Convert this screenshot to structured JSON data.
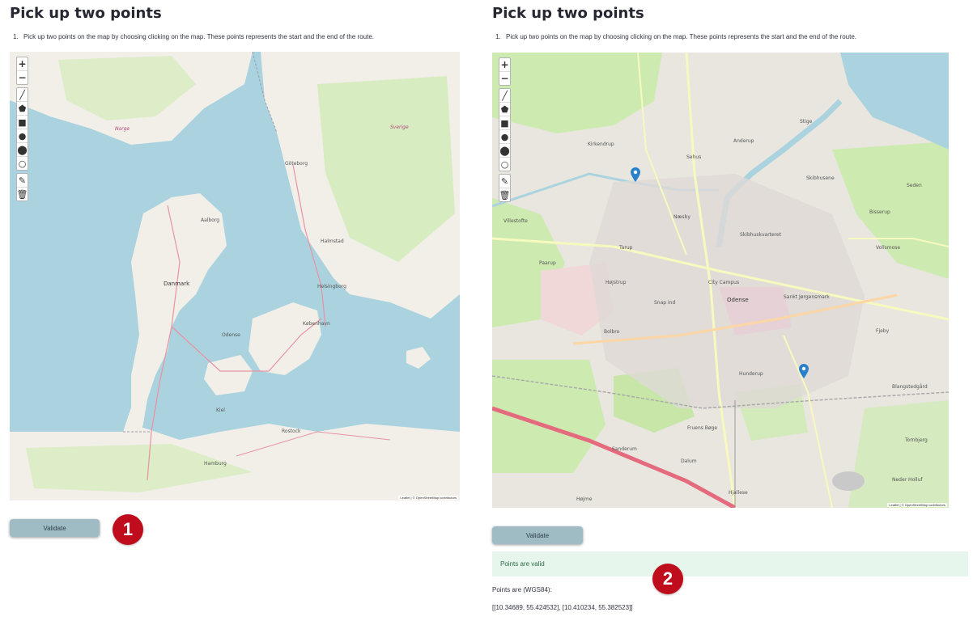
{
  "left": {
    "title": "Pick up two points",
    "instruction": "Pick up two points on the map by choosing clicking on the map. These points represents the start and the end of the route.",
    "validate_label": "Validate",
    "badge": "1",
    "attribution": "Leaflet | © OpenStreetMap contributors",
    "labels": {
      "danmark": "Danmark",
      "goteborg": "Göteborg",
      "aalborg": "Aalborg",
      "kobenhavn": "København",
      "odense": "Odense",
      "hamburg": "Hamburg",
      "kiel": "Kiel",
      "rostock": "Rostock",
      "helsingborg": "Helsingborg",
      "halmstad": "Halmstad",
      "norge": "Norge",
      "sverige": "Sverige"
    }
  },
  "right": {
    "title": "Pick up two points",
    "instruction": "Pick up two points on the map by choosing clicking on the map. These points represents the start and the end of the route.",
    "validate_label": "Validate",
    "badge": "2",
    "success_text": "Points are valid",
    "points_label": "Points are (WGS84):",
    "points_value": "[[10.34689, 55.424532], [10.410234, 55.382523]]",
    "attribution": "Leaflet | © OpenStreetMap contributors",
    "labels": {
      "odense": "Odense",
      "city_campus": "City Campus",
      "kirkendrup": "Kirkendrup",
      "sehus": "Sehus",
      "anderup": "Anderup",
      "stige": "Stige",
      "skibhusene": "Skibhusene",
      "naesby": "Næsby",
      "tarup": "Tarup",
      "hojstrup": "Højstrup",
      "bolbro": "Bolbro",
      "hunderup": "Hunderup",
      "fruens_boge": "Fruens Bøge",
      "sanderum": "Sanderum",
      "dalum": "Dalum",
      "hjallese": "Hjallese",
      "skibhuskvarteret": "Skibhuskvarteret",
      "sankt_jorgensmark": "Sankt Jørgensmark",
      "villestofte": "Villestofte",
      "paarup": "Paarup",
      "seden": "Seden",
      "bisserup": "Bisserup",
      "vollsmose": "Vollsmose",
      "fjeby": "Fjeby",
      "blangstedgard": "Blangstedgård",
      "tornbjerg": "Tornbjerg",
      "neder_holluf": "Neder Holluf",
      "snap_ind": "Snap ind",
      "hojme": "Højme"
    }
  },
  "toolbar": {
    "zoom_in": "+",
    "zoom_out": "−",
    "tools": [
      "╱",
      "⬟",
      "■",
      "●",
      "⬤",
      "○"
    ],
    "edit": "✎",
    "delete": "🗑"
  },
  "colors": {
    "water": "#aad3df",
    "land": "#f2efe9",
    "green": "#cdebb0",
    "urban": "#e0dfdf",
    "button": "#9fbcc5",
    "badge": "#c00d1e",
    "success_bg": "#e6f6ec",
    "pin": "#2a81cb"
  }
}
